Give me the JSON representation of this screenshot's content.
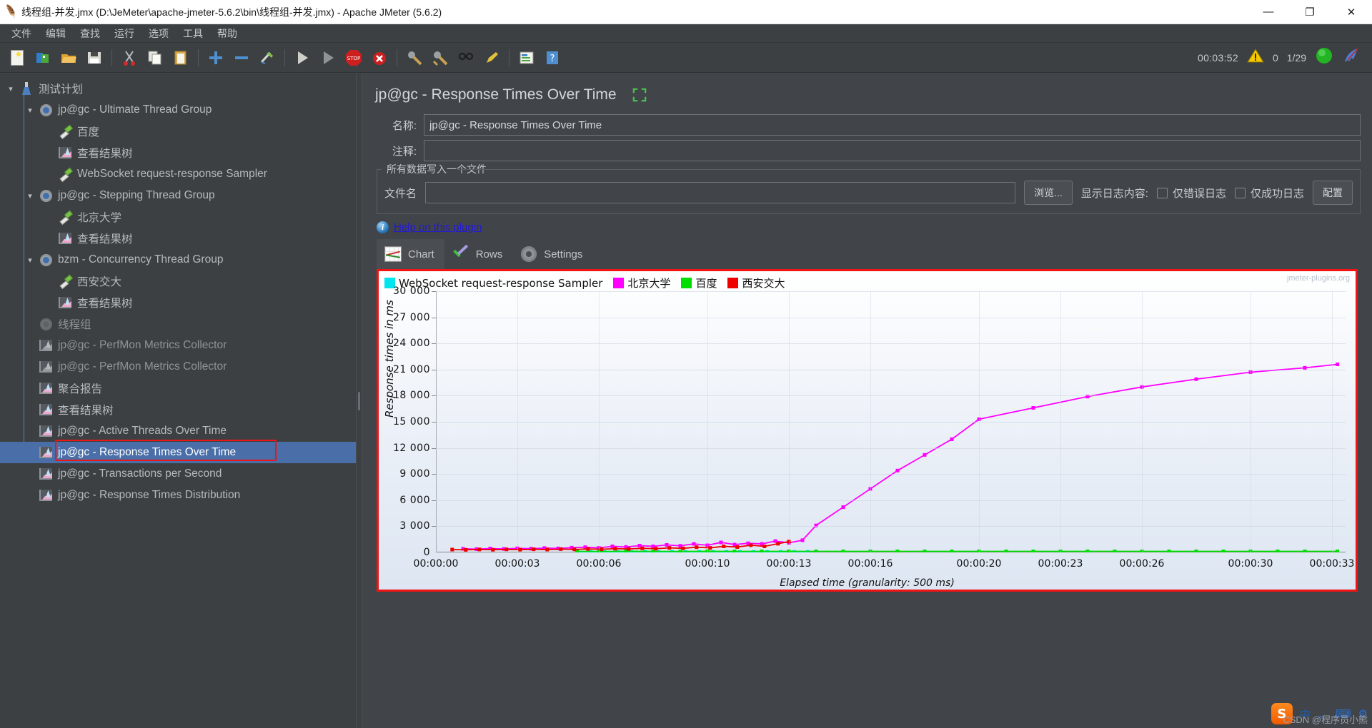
{
  "window": {
    "title": "线程组-并发.jmx (D:\\JeMeter\\apache-jmeter-5.6.2\\bin\\线程组-并发.jmx) - Apache JMeter (5.6.2)",
    "minimize": "—",
    "maximize": "❐",
    "close": "✕"
  },
  "menu": {
    "items": [
      {
        "label": "文件"
      },
      {
        "label": "编辑"
      },
      {
        "label": "查找"
      },
      {
        "label": "运行"
      },
      {
        "label": "选项"
      },
      {
        "label": "工具"
      },
      {
        "label": "帮助"
      }
    ]
  },
  "toolbar": {
    "buttons": [
      {
        "name": "new-icon",
        "glyph": "🗋"
      },
      {
        "name": "templates-icon",
        "glyph": "📗"
      },
      {
        "name": "open-icon",
        "glyph": "📂"
      },
      {
        "name": "save-icon",
        "glyph": "💾"
      },
      {
        "name": "cut-icon",
        "glyph": "✂"
      },
      {
        "name": "copy-icon",
        "glyph": "⧉"
      },
      {
        "name": "paste-icon",
        "glyph": "📋"
      },
      {
        "name": "expand-all-icon",
        "glyph": "＋"
      },
      {
        "name": "collapse-all-icon",
        "glyph": "－"
      },
      {
        "name": "toggle-icon",
        "glyph": "🖊"
      },
      {
        "name": "start-icon",
        "glyph": "▶"
      },
      {
        "name": "start-no-pauses-icon",
        "glyph": "▶"
      },
      {
        "name": "stop-icon",
        "glyph": "STOP"
      },
      {
        "name": "shutdown-icon",
        "glyph": "✖"
      },
      {
        "name": "clear-icon",
        "glyph": "🧹"
      },
      {
        "name": "clear-all-icon",
        "glyph": "🧹"
      },
      {
        "name": "search-icon",
        "glyph": "🔍"
      },
      {
        "name": "reset-search-icon",
        "glyph": "🖍"
      },
      {
        "name": "function-helper-icon",
        "glyph": "📑"
      },
      {
        "name": "help-icon",
        "glyph": "?"
      }
    ],
    "timer": "00:03:52",
    "warning_count": "0",
    "thread_count": "1/29"
  },
  "tree": {
    "items": [
      {
        "label": "测试计划",
        "depth": 0,
        "twisty": "v",
        "icon": "flask",
        "dim": false,
        "selected": false
      },
      {
        "label": "jp@gc - Ultimate Thread Group",
        "depth": 1,
        "twisty": "v",
        "icon": "gear",
        "dim": false,
        "selected": false
      },
      {
        "label": "百度",
        "depth": 2,
        "twisty": "",
        "icon": "pen",
        "dim": false,
        "selected": false
      },
      {
        "label": "查看结果树",
        "depth": 2,
        "twisty": "",
        "icon": "chart",
        "dim": false,
        "selected": false
      },
      {
        "label": "WebSocket request-response Sampler",
        "depth": 2,
        "twisty": "",
        "icon": "pen",
        "dim": false,
        "selected": false
      },
      {
        "label": "jp@gc - Stepping Thread Group",
        "depth": 1,
        "twisty": "v",
        "icon": "gear",
        "dim": false,
        "selected": false
      },
      {
        "label": "北京大学",
        "depth": 2,
        "twisty": "",
        "icon": "pen",
        "dim": false,
        "selected": false
      },
      {
        "label": "查看结果树",
        "depth": 2,
        "twisty": "",
        "icon": "chart",
        "dim": false,
        "selected": false
      },
      {
        "label": "bzm - Concurrency Thread Group",
        "depth": 1,
        "twisty": "v",
        "icon": "gear",
        "dim": false,
        "selected": false
      },
      {
        "label": "西安交大",
        "depth": 2,
        "twisty": "",
        "icon": "pen",
        "dim": false,
        "selected": false
      },
      {
        "label": "查看结果树",
        "depth": 2,
        "twisty": "",
        "icon": "chart",
        "dim": false,
        "selected": false
      },
      {
        "label": "线程组",
        "depth": 1,
        "twisty": "",
        "icon": "gear",
        "dim": true,
        "selected": false
      },
      {
        "label": "jp@gc - PerfMon Metrics Collector",
        "depth": 1,
        "twisty": "",
        "icon": "chartg",
        "dim": true,
        "selected": false
      },
      {
        "label": "jp@gc - PerfMon Metrics Collector",
        "depth": 1,
        "twisty": "",
        "icon": "chartg",
        "dim": true,
        "selected": false
      },
      {
        "label": "聚合报告",
        "depth": 1,
        "twisty": "",
        "icon": "chart",
        "dim": false,
        "selected": false
      },
      {
        "label": "查看结果树",
        "depth": 1,
        "twisty": "",
        "icon": "chart",
        "dim": false,
        "selected": false
      },
      {
        "label": "jp@gc - Active Threads Over Time",
        "depth": 1,
        "twisty": "",
        "icon": "chart",
        "dim": false,
        "selected": false
      },
      {
        "label": "jp@gc - Response Times Over Time",
        "depth": 1,
        "twisty": "",
        "icon": "chart",
        "dim": false,
        "selected": true
      },
      {
        "label": "jp@gc - Transactions per Second",
        "depth": 1,
        "twisty": "",
        "icon": "chart",
        "dim": false,
        "selected": false
      },
      {
        "label": "jp@gc - Response Times Distribution",
        "depth": 1,
        "twisty": "",
        "icon": "chart",
        "dim": false,
        "selected": false
      }
    ]
  },
  "panel": {
    "title": "jp@gc - Response Times Over Time",
    "name_label": "名称:",
    "name_value": "jp@gc - Response Times Over Time",
    "comment_label": "注释:",
    "comment_value": "",
    "group_title": "所有数据写入一个文件",
    "file_label": "文件名",
    "file_value": "",
    "browse_button": "浏览...",
    "log_display_label": "显示日志内容:",
    "error_only_label": "仅错误日志",
    "success_only_label": "仅成功日志",
    "configure_button": "配置",
    "help_link": "Help on this plugin",
    "tabs": [
      {
        "label": "Chart",
        "icon": "chart-tab-icon",
        "active": true
      },
      {
        "label": "Rows",
        "icon": "rows-tab-icon",
        "active": false
      },
      {
        "label": "Settings",
        "icon": "settings-tab-icon",
        "active": false
      }
    ]
  },
  "chart_data": {
    "type": "line",
    "title": "",
    "xlabel": "Elapsed time (granularity: 500 ms)",
    "ylabel": "Response times in ms",
    "watermark": "jmeter-plugins.org",
    "ylim": [
      0,
      30000
    ],
    "yticks": [
      0,
      3000,
      6000,
      9000,
      12000,
      15000,
      18000,
      21000,
      24000,
      27000,
      30000
    ],
    "ytick_labels": [
      "0",
      "3 000",
      "6 000",
      "9 000",
      "12 000",
      "15 000",
      "18 000",
      "21 000",
      "24 000",
      "27 000",
      "30 000"
    ],
    "xtick_labels": [
      "00:00:00",
      "00:00:03",
      "00:00:06",
      "00:00:10",
      "00:00:13",
      "00:00:16",
      "00:00:20",
      "00:00:23",
      "00:00:26",
      "00:00:30",
      "00:00:33"
    ],
    "xtick_seconds": [
      0,
      3,
      6,
      10,
      13,
      16,
      20,
      23,
      26,
      30,
      33
    ],
    "xlim": [
      0,
      33.5
    ],
    "grid": true,
    "legend_position": "top-left",
    "series": [
      {
        "name": "WebSocket request-response Sampler",
        "color": "#00e5ee",
        "points": [
          [
            5.2,
            60
          ],
          [
            5.7,
            60
          ],
          [
            6.2,
            60
          ],
          [
            6.7,
            55
          ],
          [
            7.2,
            60
          ],
          [
            7.7,
            65
          ],
          [
            8.2,
            60
          ],
          [
            8.7,
            60
          ],
          [
            9.2,
            65
          ],
          [
            9.7,
            60
          ],
          [
            10.2,
            60
          ],
          [
            10.7,
            65
          ],
          [
            11.2,
            60
          ],
          [
            11.7,
            60
          ],
          [
            12.2,
            60
          ],
          [
            12.7,
            60
          ],
          [
            13.2,
            60
          ],
          [
            13.7,
            60
          ]
        ]
      },
      {
        "name": "北京大学",
        "color": "#ff00ff",
        "points": [
          [
            1.0,
            420
          ],
          [
            1.5,
            380
          ],
          [
            2.0,
            450
          ],
          [
            2.5,
            400
          ],
          [
            3.0,
            470
          ],
          [
            3.5,
            430
          ],
          [
            4.0,
            500
          ],
          [
            4.5,
            460
          ],
          [
            5.0,
            540
          ],
          [
            5.5,
            600
          ],
          [
            6.0,
            520
          ],
          [
            6.5,
            700
          ],
          [
            7.0,
            620
          ],
          [
            7.5,
            780
          ],
          [
            8.0,
            700
          ],
          [
            8.5,
            860
          ],
          [
            9.0,
            760
          ],
          [
            9.5,
            980
          ],
          [
            10.0,
            820
          ],
          [
            10.5,
            1150
          ],
          [
            11.0,
            900
          ],
          [
            11.5,
            1050
          ],
          [
            12.0,
            980
          ],
          [
            12.5,
            1300
          ],
          [
            13.0,
            1100
          ],
          [
            13.5,
            1400
          ],
          [
            14.0,
            3100
          ],
          [
            15.0,
            5200
          ],
          [
            16.0,
            7300
          ],
          [
            17.0,
            9400
          ],
          [
            18.0,
            11200
          ],
          [
            19.0,
            13000
          ],
          [
            20.0,
            15300
          ],
          [
            22.0,
            16600
          ],
          [
            24.0,
            17900
          ],
          [
            26.0,
            19000
          ],
          [
            28.0,
            19900
          ],
          [
            30.0,
            20700
          ],
          [
            32.0,
            21200
          ],
          [
            33.2,
            21600
          ]
        ]
      },
      {
        "name": "百度",
        "color": "#00dd00",
        "points": [
          [
            5.2,
            120
          ],
          [
            6.0,
            110
          ],
          [
            7.0,
            130
          ],
          [
            8.0,
            120
          ],
          [
            9.0,
            115
          ],
          [
            10.0,
            130
          ],
          [
            11.0,
            120
          ],
          [
            12.0,
            125
          ],
          [
            13.0,
            120
          ],
          [
            14.0,
            120
          ],
          [
            15.0,
            118
          ],
          [
            16.0,
            122
          ],
          [
            17.0,
            120
          ],
          [
            18.0,
            120
          ],
          [
            19.0,
            118
          ],
          [
            20.0,
            122
          ],
          [
            21.0,
            120
          ],
          [
            22.0,
            120
          ],
          [
            23.0,
            118
          ],
          [
            24.0,
            122
          ],
          [
            25.0,
            120
          ],
          [
            26.0,
            120
          ],
          [
            27.0,
            118
          ],
          [
            28.0,
            122
          ],
          [
            29.0,
            120
          ],
          [
            30.0,
            120
          ],
          [
            31.0,
            118
          ],
          [
            32.0,
            122
          ],
          [
            33.2,
            120
          ]
        ]
      },
      {
        "name": "西安交大",
        "color": "#ee0000",
        "points": [
          [
            0.6,
            330
          ],
          [
            1.1,
            300
          ],
          [
            1.6,
            340
          ],
          [
            2.1,
            310
          ],
          [
            2.6,
            350
          ],
          [
            3.1,
            320
          ],
          [
            3.6,
            360
          ],
          [
            4.1,
            330
          ],
          [
            4.6,
            380
          ],
          [
            5.1,
            350
          ],
          [
            5.6,
            400
          ],
          [
            6.1,
            370
          ],
          [
            6.6,
            430
          ],
          [
            7.1,
            400
          ],
          [
            7.6,
            470
          ],
          [
            8.1,
            430
          ],
          [
            8.6,
            520
          ],
          [
            9.1,
            470
          ],
          [
            9.6,
            600
          ],
          [
            10.1,
            520
          ],
          [
            10.6,
            700
          ],
          [
            11.1,
            620
          ],
          [
            11.6,
            830
          ],
          [
            12.1,
            700
          ],
          [
            12.6,
            1000
          ],
          [
            13.0,
            1250
          ]
        ]
      }
    ]
  },
  "tray": {
    "ime_brand": "S",
    "ime_mode": "中",
    "ime_punct": "，",
    "watermark": "CSDN @程序员小熊"
  }
}
